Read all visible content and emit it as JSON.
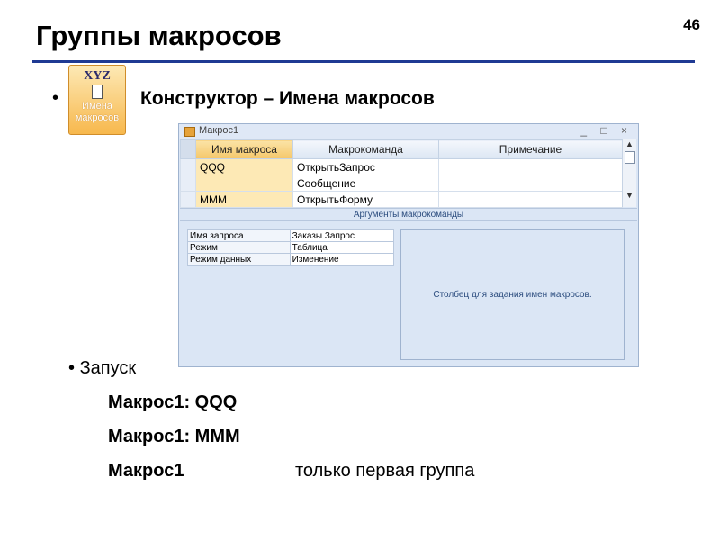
{
  "slide": {
    "title": "Группы макросов",
    "page_number": "46"
  },
  "ribbon_button": {
    "icon_text": "XYZ",
    "label_line1": "Имена",
    "label_line2": "макросов"
  },
  "bullets": {
    "first_heading": "Конструктор – Имена макросов",
    "second_heading": "Запуск"
  },
  "window": {
    "title": "Макрос1",
    "controls": "_ □ ×",
    "columns": [
      "Имя макроса",
      "Макрокоманда",
      "Примечание"
    ],
    "rows": [
      {
        "name": "QQQ",
        "action": "ОткрытьЗапрос",
        "note": ""
      },
      {
        "name": "",
        "action": "Сообщение",
        "note": ""
      },
      {
        "name": "MMM",
        "action": "ОткрытьФорму",
        "note": ""
      }
    ],
    "arguments_header": "Аргументы макрокоманды",
    "arguments": [
      {
        "name": "Имя запроса",
        "value": "Заказы Запрос"
      },
      {
        "name": "Режим",
        "value": "Таблица"
      },
      {
        "name": "Режим данных",
        "value": "Изменение"
      }
    ],
    "help_text": "Столбец для задания имен макросов."
  },
  "launch": {
    "items": [
      "Макрос1: QQQ",
      "Макрос1: MMM",
      "Макрос1"
    ],
    "note": "только первая группа"
  }
}
